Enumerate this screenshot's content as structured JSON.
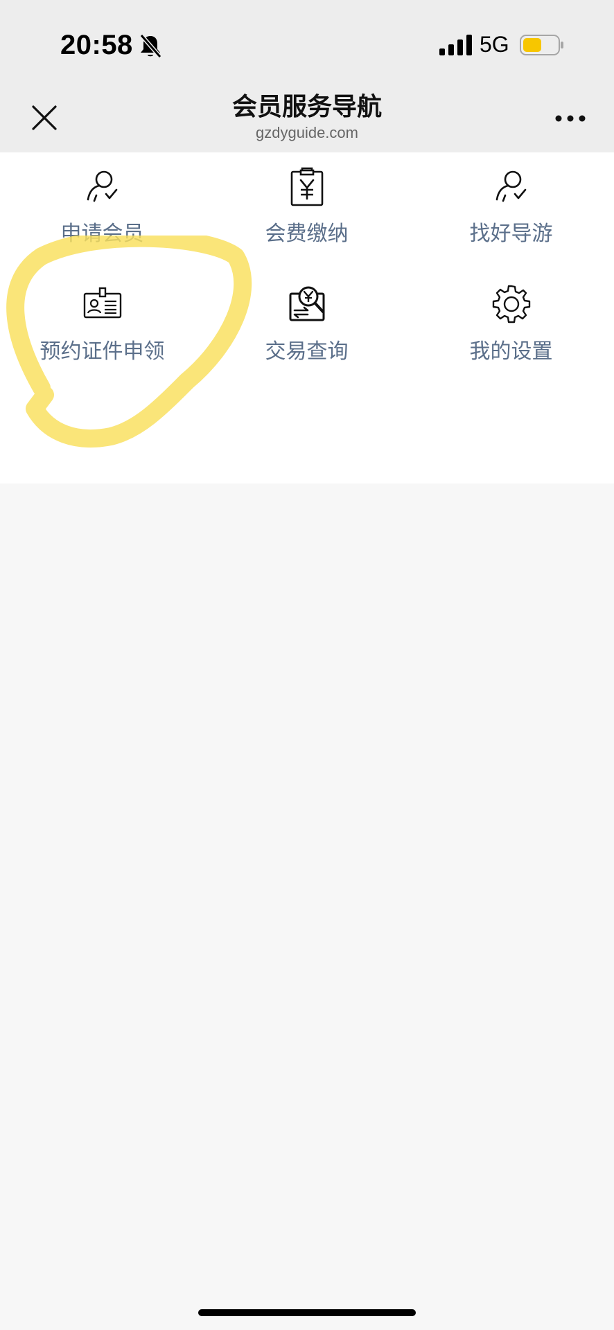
{
  "status_bar": {
    "time": "20:58",
    "network": "5G",
    "battery_color": "#f7c600"
  },
  "nav": {
    "title": "会员服务导航",
    "subtitle": "gzdyguide.com"
  },
  "menu_items": [
    {
      "label": "申请会员",
      "icon": "person-check-icon"
    },
    {
      "label": "会费缴纳",
      "icon": "clipboard-yen-icon"
    },
    {
      "label": "找好导游",
      "icon": "person-check-icon"
    },
    {
      "label": "预约证件申领",
      "icon": "id-card-icon"
    },
    {
      "label": "交易查询",
      "icon": "yen-search-icon"
    },
    {
      "label": "我的设置",
      "icon": "gear-icon"
    }
  ],
  "colors": {
    "label_text": "#5b6f8a",
    "highlight": "#f9df5c",
    "page_background": "#f7f7f7",
    "header_background": "#ededed"
  }
}
